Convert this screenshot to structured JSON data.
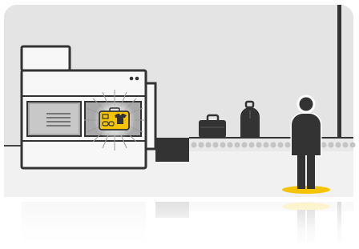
{
  "scene": {
    "icons": [
      "x-ray-scanner-icon",
      "scanner-screen-bag-icon",
      "briefcase-icon",
      "backpack-icon",
      "traveler-icon",
      "conveyor-belt-icon"
    ],
    "colors": {
      "background": "#ffffff",
      "panel": "#e4e4e4",
      "floor": "#f0f0f0",
      "outline": "#333333",
      "machine_fill": "#f7f7f7",
      "dark": "#2e2e2e",
      "accent": "#f5c400",
      "glow": "#bbbbbb"
    }
  }
}
